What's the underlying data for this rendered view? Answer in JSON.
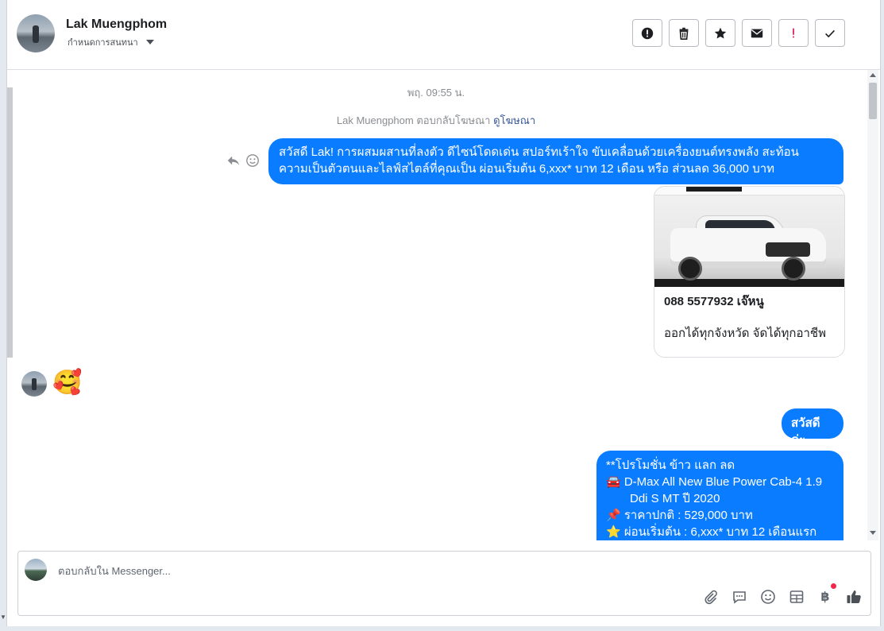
{
  "header": {
    "contact_name": "Lak Muengphom",
    "assign_label": "กำหนดการสนทนา",
    "actions": [
      {
        "name": "spam-button",
        "icon": "exclamation-circle-icon"
      },
      {
        "name": "delete-button",
        "icon": "trash-icon"
      },
      {
        "name": "follow-up-button",
        "icon": "star-icon"
      },
      {
        "name": "mark-unread-button",
        "icon": "envelope-icon"
      },
      {
        "name": "mark-important-button",
        "icon": "exclamation-icon"
      },
      {
        "name": "mark-done-button",
        "icon": "check-icon"
      }
    ]
  },
  "conversation": {
    "timestamp": "พฤ. 09:55 น.",
    "reply_note": "Lak Muengphom ตอบกลับโฆษณา",
    "reply_note_link": "ดูโฆษณา",
    "messages": {
      "ad_message_line1": "สวัสดี Lak! การผสมผสานที่ลงตัว ดีไซน์โดดเด่น สปอร์ทเร้าใจ ขับเคลื่อนด้วยเครื่องยนต์ทรงพลัง สะท้อน",
      "ad_message_line2": "ความเป็นตัวตนและไลฟ์สไตล์ที่คุณเป็น ผ่อนเริ่มต้น 6,xxx* บาท 12 เดือน หรือ ส่วนลด 36,000 บาท",
      "card_phone": "088 5577932 เจ๊หนู",
      "card_desc": "ออกได้ทุกจังหวัด จัดได้ทุกอาชีพ",
      "customer_reaction": "🥰",
      "greeting": "สวัสดีค่ะ",
      "promo_lines": [
        "**โปรโมชั่น ข้าว แลก ลด",
        "🚘 D-Max All New Blue Power Cab-4 1.9",
        "Ddi S MT  ปี 2020",
        "📌 ราคาปกติ : 529,000 บาท",
        "⭐ ผ่อนเริ่มต้น : 6,xxx* บาท 12 เดือนแรก"
      ]
    }
  },
  "composer": {
    "placeholder": "ตอบกลับใน Messenger...",
    "baht_symbol": "฿",
    "tools": [
      "paperclip-icon",
      "chat-bubble-icon",
      "smiley-icon",
      "table-icon",
      "baht-icon",
      "thumbs-up-icon"
    ]
  },
  "colors": {
    "bubble": "#0a7cff",
    "accent_link": "#385898",
    "important_red": "#e0245e"
  }
}
